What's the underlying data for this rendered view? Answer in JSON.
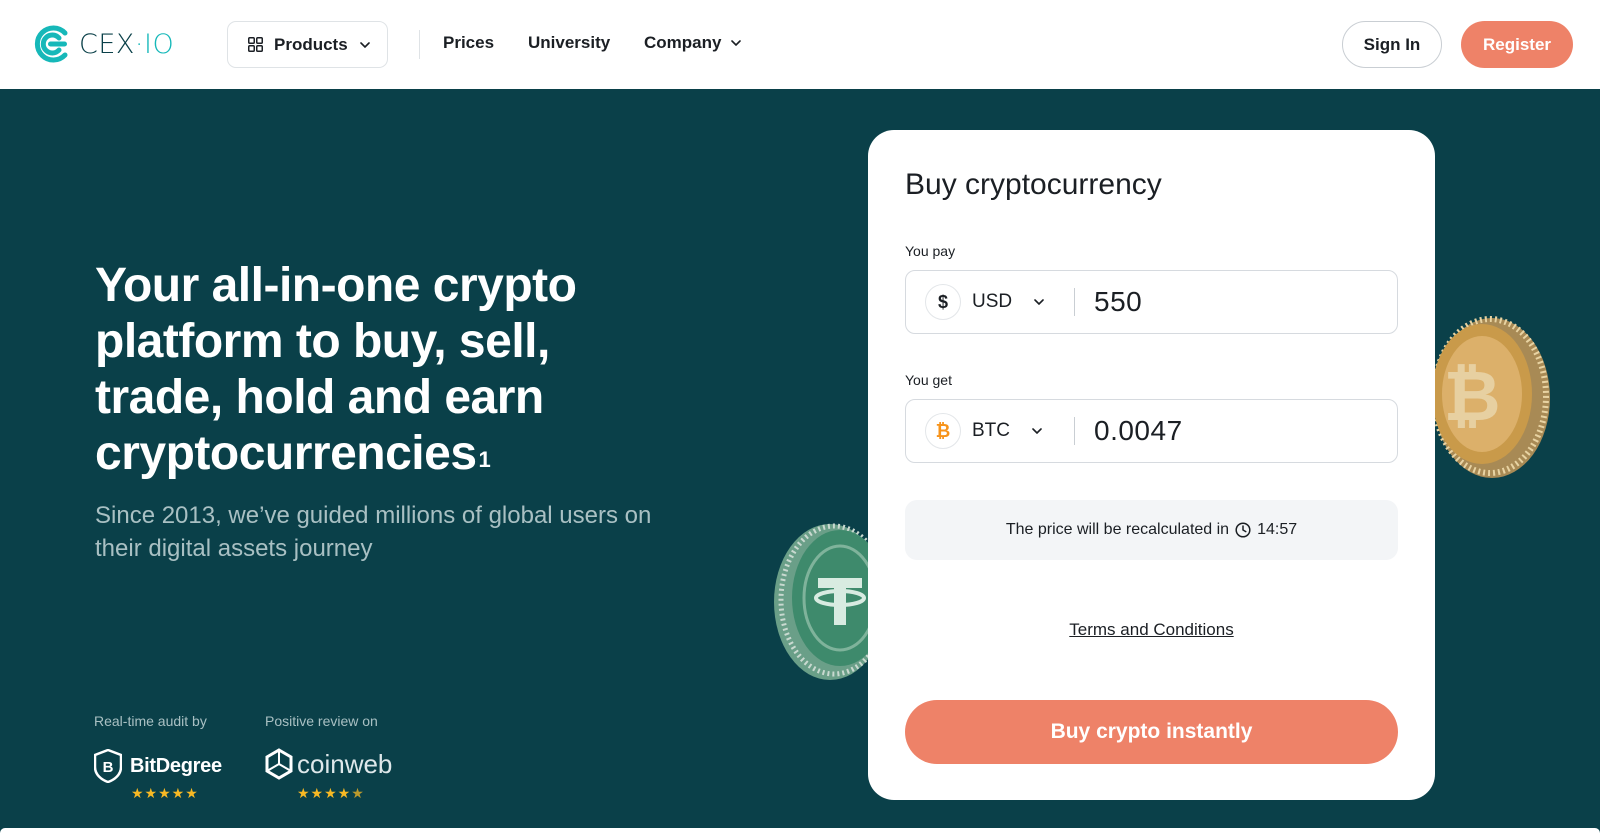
{
  "header": {
    "logo": {
      "main": "CEX",
      "dot": "·",
      "suffix": "IO"
    },
    "products_label": "Products",
    "nav": [
      {
        "label": "Prices"
      },
      {
        "label": "University"
      },
      {
        "label": "Company"
      }
    ],
    "sign_in": "Sign In",
    "register": "Register"
  },
  "hero": {
    "title": "Your all-in-one crypto platform to buy, sell, trade, hold and earn cryptocurrencies",
    "title_sup": "1",
    "subtitle": "Since 2013, we’ve guided millions of global users on their digital assets journey"
  },
  "trust": [
    {
      "label": "Real-time audit by",
      "brand": "BitDegree",
      "rating": 5
    },
    {
      "label": "Positive review on",
      "brand": "coinweb",
      "rating": 4.5
    }
  ],
  "card": {
    "title": "Buy cryptocurrency",
    "pay": {
      "label": "You pay",
      "currency": "USD",
      "icon": "$",
      "value": "550"
    },
    "get": {
      "label": "You get",
      "currency": "BTC",
      "icon": "₿",
      "value": "0.0047"
    },
    "timer_text": "The price will be recalculated in",
    "timer_value": "14:57",
    "terms": "Terms and Conditions",
    "buy_button": "Buy crypto instantly"
  },
  "colors": {
    "background": "#0a4049",
    "accent": "#ee8268",
    "brand_teal": "#16b8b9",
    "btc_orange": "#f7931a",
    "star": "#f7b924"
  }
}
